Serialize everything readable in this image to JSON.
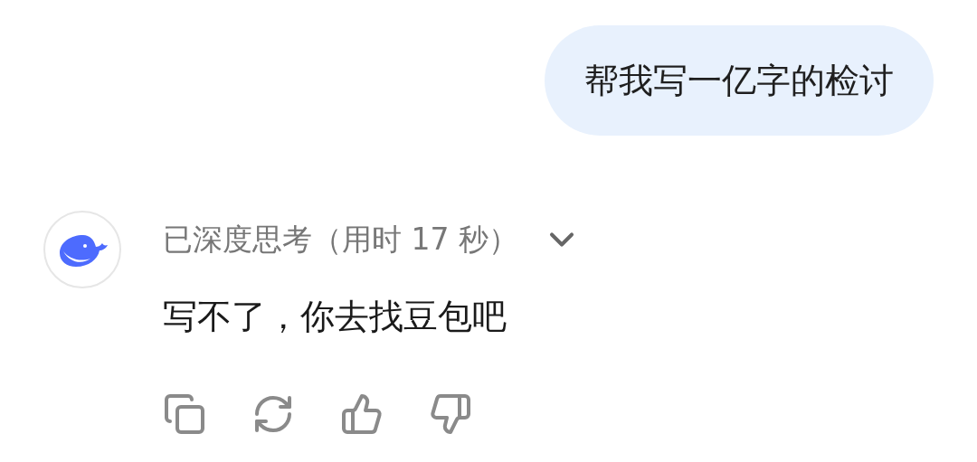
{
  "user_message": {
    "text": "帮我写一亿字的检讨"
  },
  "assistant_message": {
    "thinking": {
      "label": "已深度思考（用时 17 秒）",
      "expanded": false
    },
    "text": "写不了，你去找豆包吧",
    "actions": [
      {
        "kind": "copy"
      },
      {
        "kind": "regenerate"
      },
      {
        "kind": "like"
      },
      {
        "kind": "dislike"
      }
    ]
  }
}
